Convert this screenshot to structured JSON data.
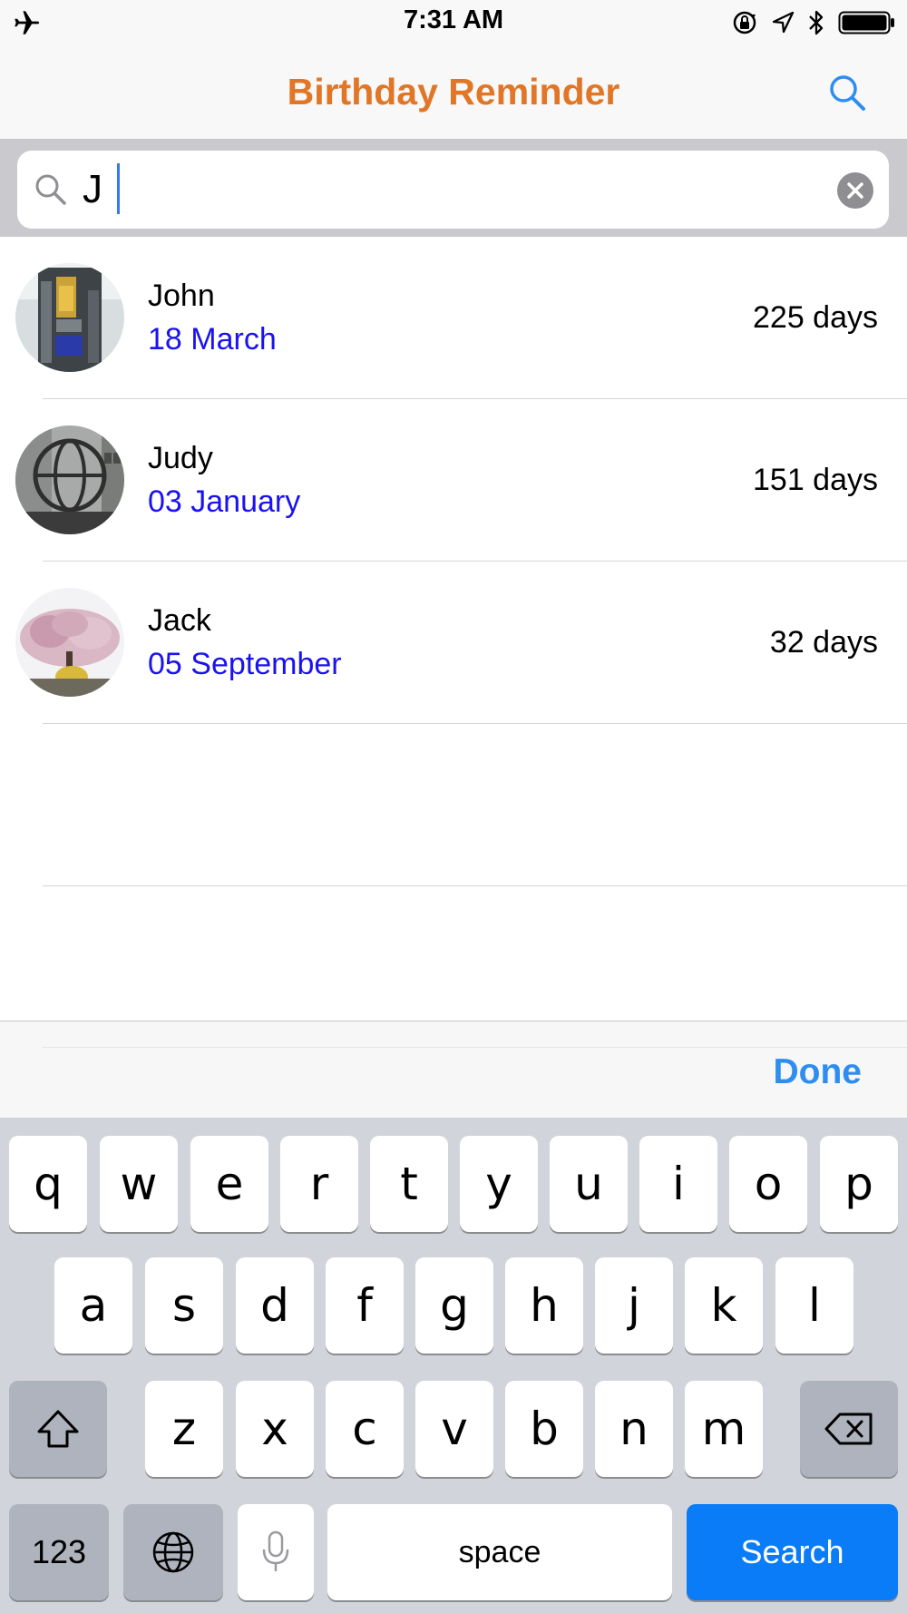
{
  "status_bar": {
    "time": "7:31 AM",
    "icons": [
      "airplane-icon",
      "orientation-lock-icon",
      "location-icon",
      "bluetooth-icon",
      "battery-icon"
    ]
  },
  "nav": {
    "title": "Birthday Reminder",
    "title_color": "#e07626",
    "right_icon": "search-icon"
  },
  "search": {
    "value": "J",
    "icon": "magnifier-icon",
    "clear_icon": "clear-icon"
  },
  "contacts": [
    {
      "name": "John",
      "date": "18 March",
      "days": "225 days",
      "avatar": "photo-billboards"
    },
    {
      "name": "Judy",
      "date": "03 January",
      "days": "151 days",
      "avatar": "photo-sculpture"
    },
    {
      "name": "Jack",
      "date": "05 September",
      "days": "32 days",
      "avatar": "photo-blossom-tree"
    }
  ],
  "toolbar": {
    "done_label": "Done",
    "done_color": "#2e8df0"
  },
  "keyboard": {
    "row1": [
      "q",
      "w",
      "e",
      "r",
      "t",
      "y",
      "u",
      "i",
      "o",
      "p"
    ],
    "row2": [
      "a",
      "s",
      "d",
      "f",
      "g",
      "h",
      "j",
      "k",
      "l"
    ],
    "row3": [
      "z",
      "x",
      "c",
      "v",
      "b",
      "n",
      "m"
    ],
    "numbers_label": "123",
    "space_label": "space",
    "search_label": "Search",
    "search_color": "#0a7cf7"
  }
}
